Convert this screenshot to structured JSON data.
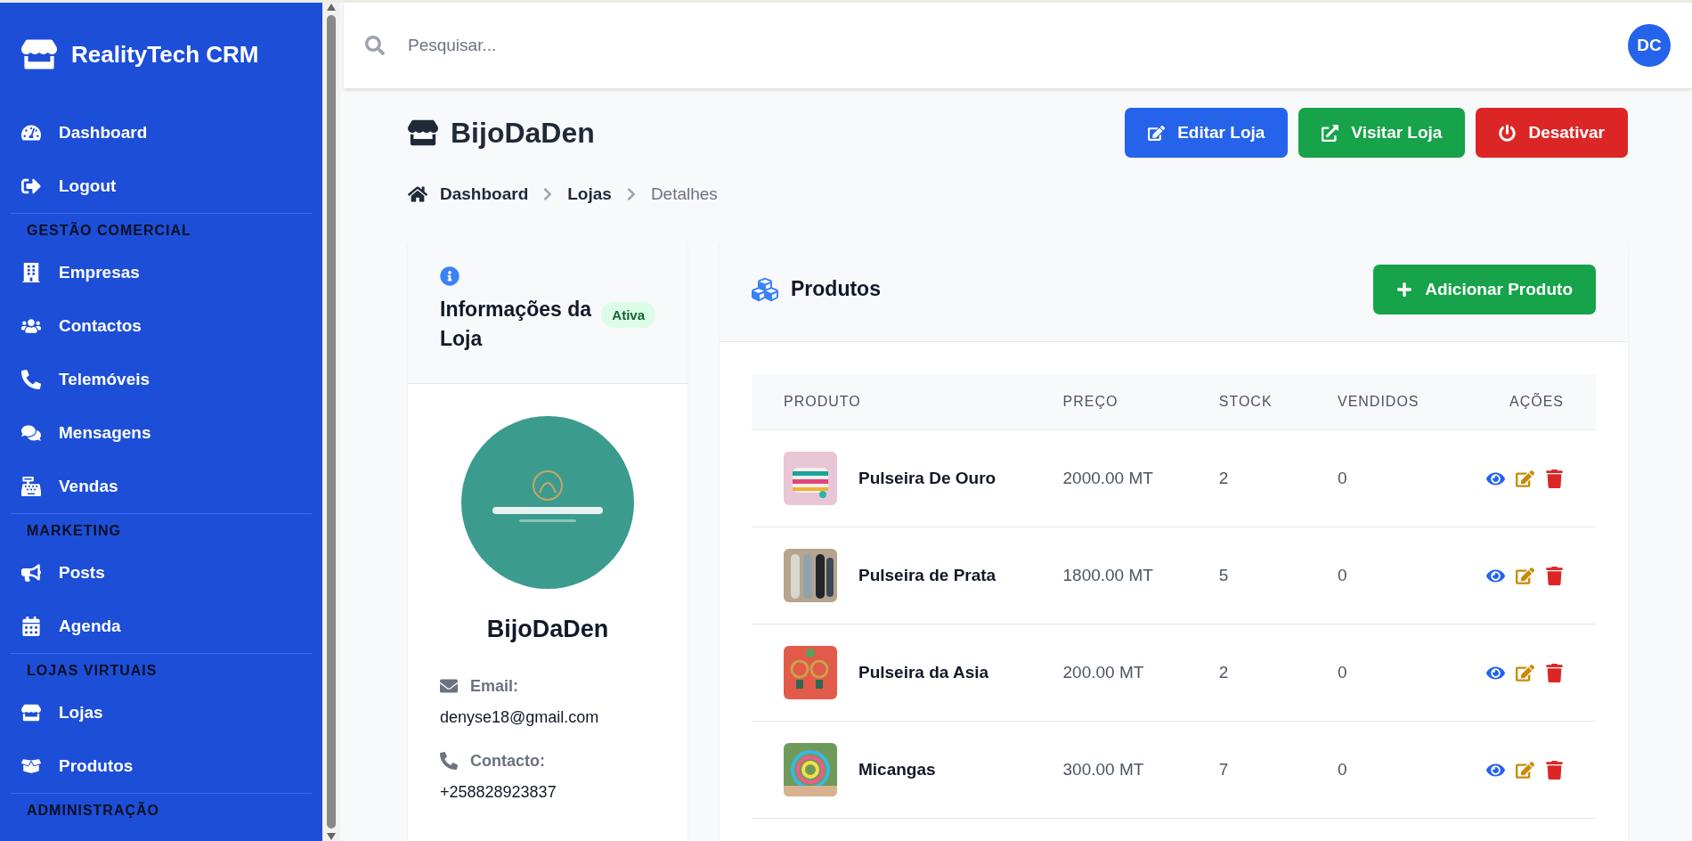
{
  "sidebar": {
    "brand": "RealityTech CRM",
    "sections": [
      {
        "items": [
          {
            "label": "Dashboard"
          },
          {
            "label": "Logout"
          }
        ]
      },
      {
        "heading": "GESTÃO COMERCIAL",
        "items": [
          {
            "label": "Empresas"
          },
          {
            "label": "Contactos"
          },
          {
            "label": "Telemóveis"
          },
          {
            "label": "Mensagens"
          },
          {
            "label": "Vendas"
          }
        ]
      },
      {
        "heading": "MARKETING",
        "items": [
          {
            "label": "Posts"
          },
          {
            "label": "Agenda"
          }
        ]
      },
      {
        "heading": "LOJAS VIRTUAIS",
        "items": [
          {
            "label": "Lojas"
          },
          {
            "label": "Produtos"
          }
        ]
      },
      {
        "heading": "ADMINISTRAÇÃO"
      }
    ]
  },
  "topbar": {
    "search": {
      "placeholder": "Pesquisar..."
    },
    "avatar": "DC"
  },
  "page": {
    "title": "BijoDaDen",
    "actions": [
      {
        "kind": "edit",
        "label": "Editar Loja"
      },
      {
        "kind": "visit",
        "label": "Visitar Loja"
      },
      {
        "kind": "deactivate",
        "label": "Desativar"
      }
    ],
    "breadcrumb": [
      {
        "label": "Dashboard",
        "current": false
      },
      {
        "label": "Lojas",
        "current": false
      },
      {
        "label": "Detalhes",
        "current": true
      }
    ]
  },
  "store_info": {
    "title": "Informações da Loja",
    "status": "Ativa",
    "name": "BijoDaDen",
    "fields": [
      {
        "label": "Email:",
        "value": "denyse18@gmail.com"
      },
      {
        "label": "Contacto:",
        "value": "+258828923837"
      }
    ]
  },
  "products": {
    "title": "Produtos",
    "add_button": "Adicionar Produto",
    "columns": [
      "PRODUTO",
      "PREÇO",
      "STOCK",
      "VENDIDOS",
      "AÇÕES"
    ],
    "rows": [
      {
        "name": "Pulseira De Ouro",
        "price": "2000.00 MT",
        "stock": "2",
        "sold": "0"
      },
      {
        "name": "Pulseira de Prata",
        "price": "1800.00 MT",
        "stock": "5",
        "sold": "0"
      },
      {
        "name": "Pulseira da Asia",
        "price": "200.00 MT",
        "stock": "2",
        "sold": "0"
      },
      {
        "name": "Micangas",
        "price": "300.00 MT",
        "stock": "7",
        "sold": "0"
      }
    ]
  }
}
